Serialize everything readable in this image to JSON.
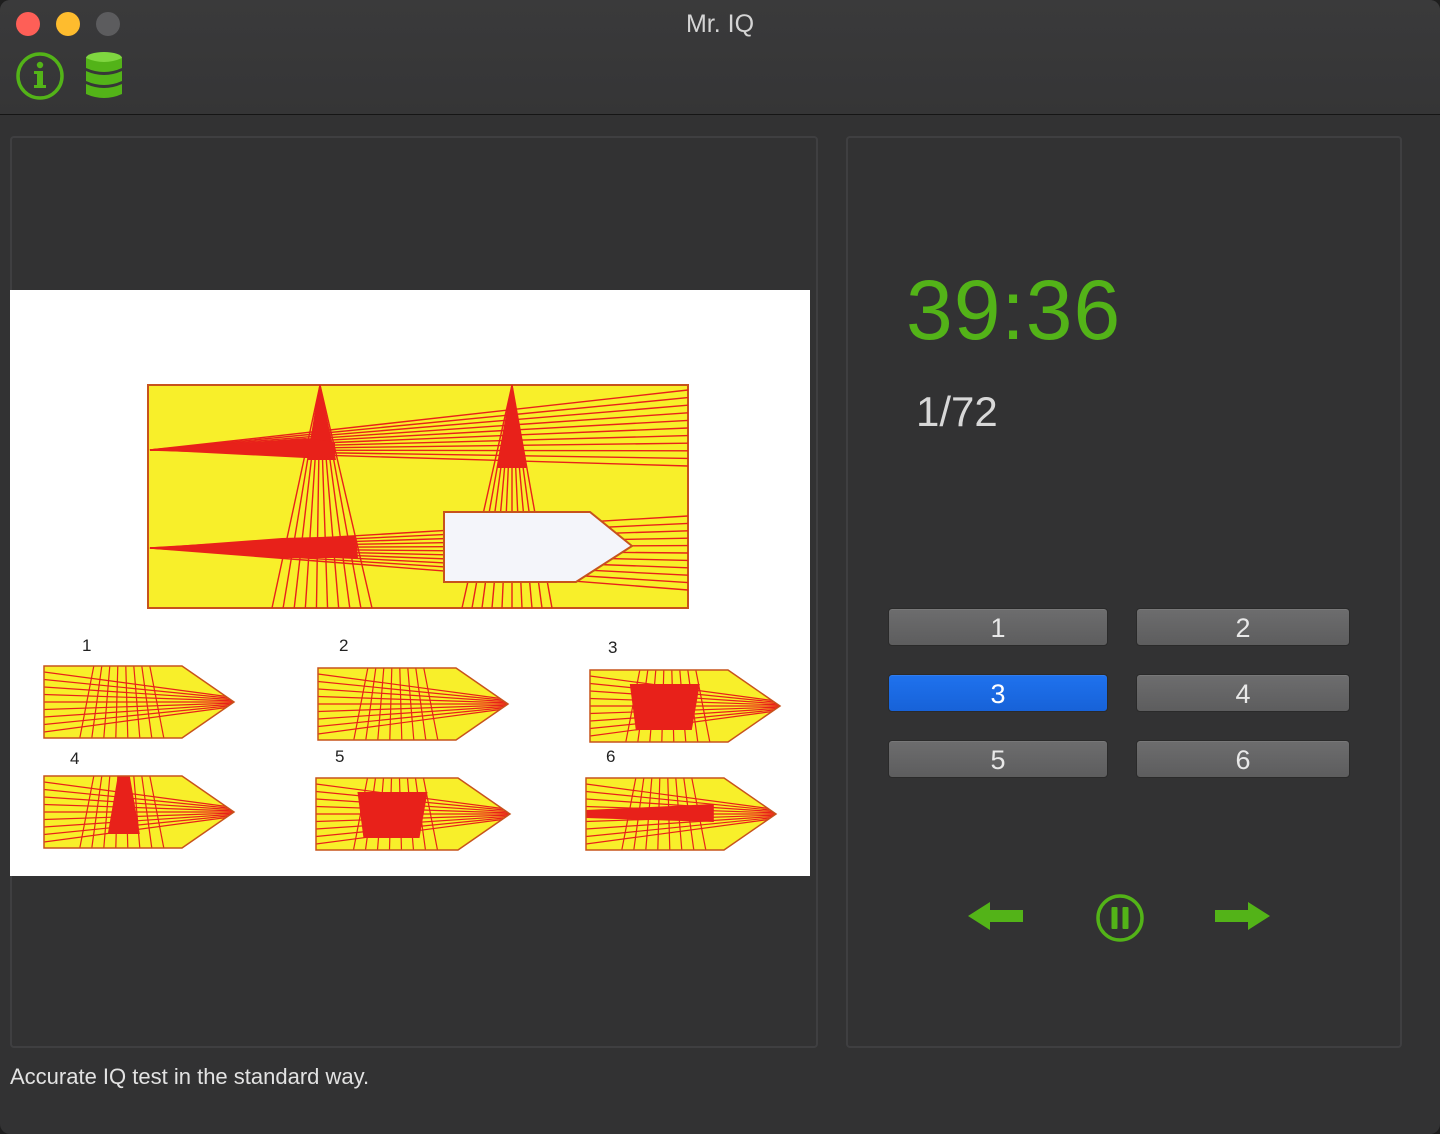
{
  "window": {
    "title": "Mr. IQ"
  },
  "toolbar": {
    "info_icon": "info-circle-icon",
    "database_icon": "database-icon"
  },
  "question": {
    "image": "puzzle-figure",
    "option_labels": [
      "1",
      "2",
      "3",
      "4",
      "5",
      "6"
    ]
  },
  "timer": {
    "value": "39:36"
  },
  "progress": {
    "counter": "1/72"
  },
  "answers": {
    "buttons": [
      "1",
      "2",
      "3",
      "4",
      "5",
      "6"
    ],
    "selected": "3"
  },
  "navigation": {
    "prev_icon": "arrow-left-icon",
    "pause_icon": "pause-circle-icon",
    "next_icon": "arrow-right-icon"
  },
  "status_bar": {
    "text": "Accurate IQ test in the standard way."
  },
  "colors": {
    "accent_green": "#53b318",
    "selected_blue": "#1f72ee",
    "figure_yellow": "#f8ef2a",
    "figure_red": "#e8211a"
  }
}
